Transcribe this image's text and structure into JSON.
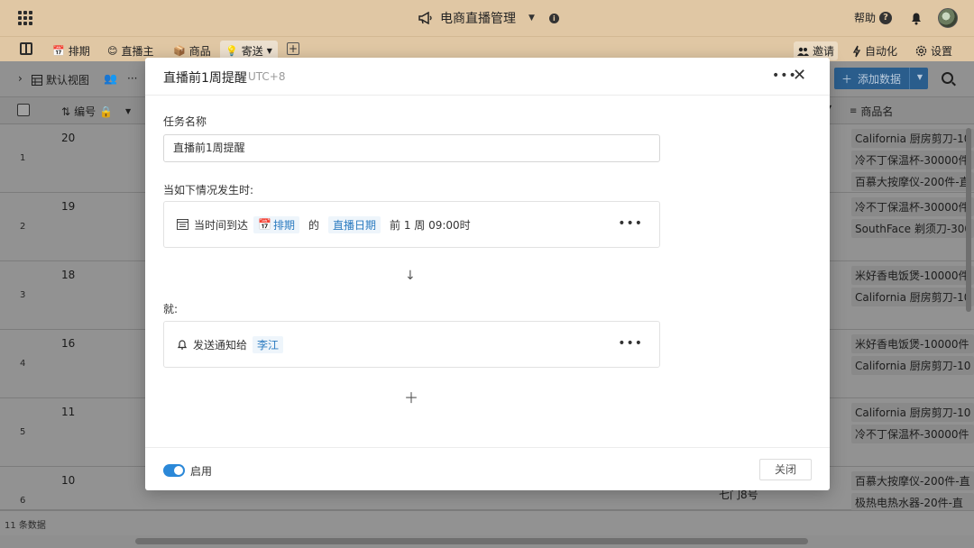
{
  "app": {
    "title": "电商直播管理",
    "help": "帮助"
  },
  "tabs": [
    {
      "icon": "📅",
      "label": "排期"
    },
    {
      "icon": "😊",
      "label": "直播主"
    },
    {
      "icon": "📦",
      "label": "商品"
    },
    {
      "icon": "💡",
      "label": "寄送"
    }
  ],
  "tab_add": "+",
  "right_tools": {
    "invite": "邀请",
    "automation": "自动化",
    "settings": "设置"
  },
  "toolbar": {
    "view": "默认视图",
    "add_data": "添加数据"
  },
  "table": {
    "headers": {
      "number": "编号",
      "product": "商品名"
    },
    "rows": [
      {
        "index": "1",
        "number": "20",
        "products": [
          "California 厨房剪刀-10",
          "冷不丁保温杯-30000件",
          "百慕大按摩仪-200件-直"
        ]
      },
      {
        "index": "2",
        "number": "19",
        "products": [
          "冷不丁保温杯-30000件",
          "SouthFace 剃须刀-300"
        ]
      },
      {
        "index": "3",
        "number": "18",
        "products": [
          "米好香电饭煲-10000件",
          "California 厨房剪刀-10"
        ]
      },
      {
        "index": "4",
        "number": "16",
        "products": [
          "米好香电饭煲-10000件",
          "California 厨房剪刀-10"
        ]
      },
      {
        "index": "5",
        "number": "11",
        "products": [
          "California 厨房剪刀-10",
          "冷不丁保温杯-30000件"
        ]
      },
      {
        "index": "6",
        "number": "10",
        "products": [
          "百慕大按摩仪-200件-直",
          "极热电热水器-20件-直"
        ],
        "address": "七门8号"
      }
    ],
    "footer_count": "11 条数据"
  },
  "modal": {
    "title": "直播前1周提醒",
    "timezone": "UTC+8",
    "name_label": "任务名称",
    "name_value": "直播前1周提醒",
    "trigger_label": "当如下情况发生时:",
    "trigger": {
      "prefix": "当时间到达",
      "table_icon": "📅",
      "table": "排期",
      "of": "的",
      "field": "直播日期",
      "suffix": "前 1 周 09:00时"
    },
    "then_label": "就:",
    "action": {
      "text": "发送通知给",
      "person": "李江"
    },
    "enable_label": "启用",
    "close_label": "关闭",
    "enabled": true
  },
  "colors": {
    "topbar": "#e0c7a4",
    "accent": "#2b88d8",
    "pill_text": "#2b7bc0"
  }
}
